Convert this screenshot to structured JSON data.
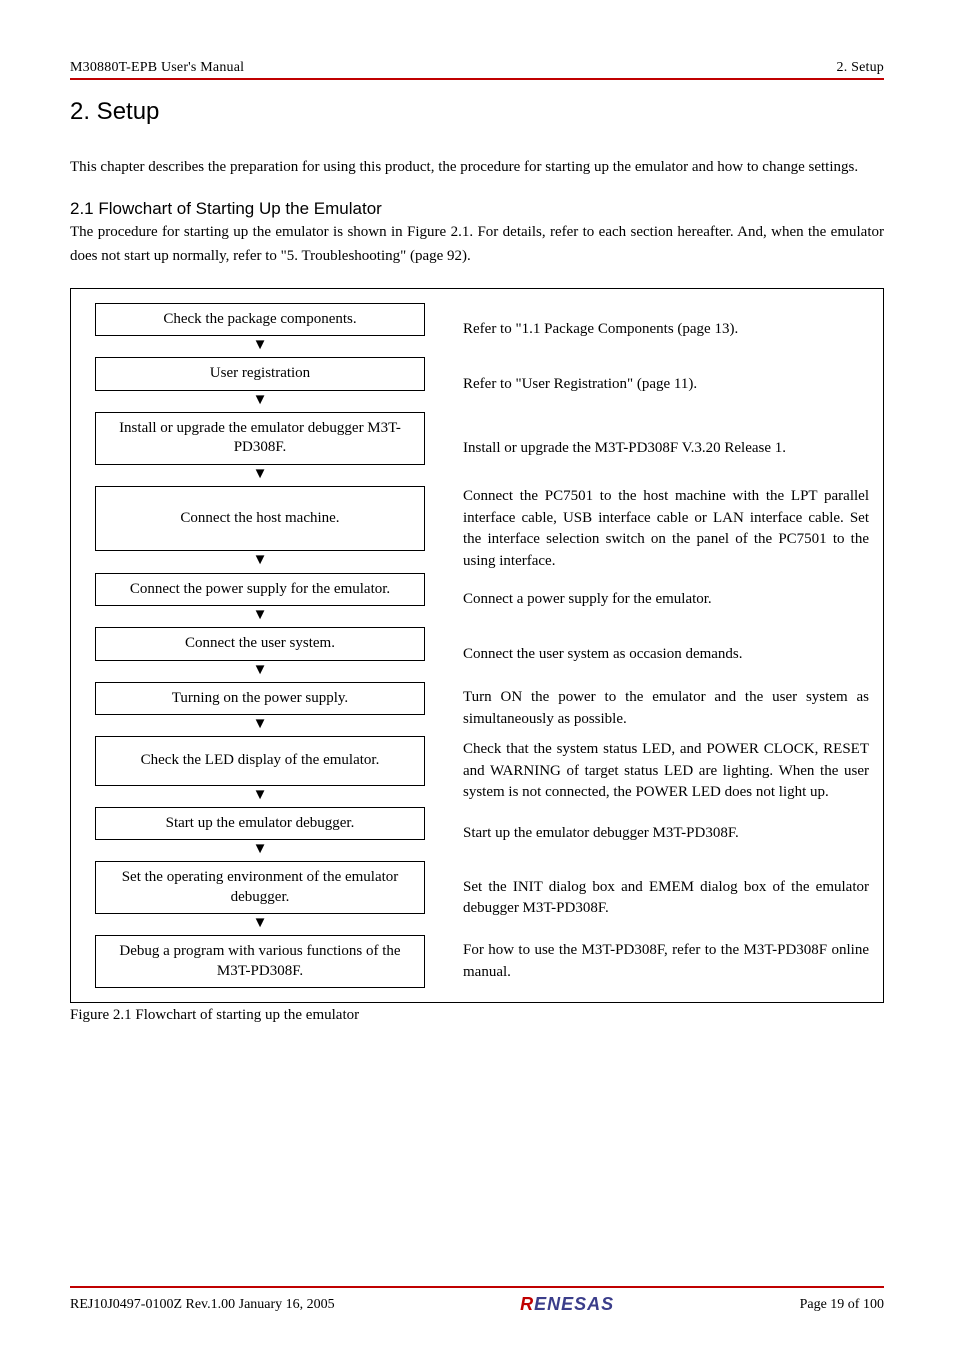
{
  "header": {
    "left": "M30880T-EPB User's Manual",
    "right": "2. Setup"
  },
  "title": "2. Setup",
  "intro": "This chapter describes the preparation for using this product, the procedure for starting up the emulator and how to change settings.",
  "section_heading": "2.1 Flowchart of Starting Up the Emulator",
  "section_intro": "The procedure for starting up the emulator is shown in Figure 2.1. For details, refer to each section hereafter. And, when the emulator does not start up normally, refer to \"5. Troubleshooting\" (page 92).",
  "steps": [
    {
      "box": "Check the package components.",
      "desc": "Refer to \"1.1 Package Components (page 13)."
    },
    {
      "box": "User registration",
      "desc": "Refer to \"User Registration\" (page 11)."
    },
    {
      "box": "Install or upgrade the emulator debugger M3T-PD308F.",
      "desc": "Install or upgrade the M3T-PD308F V.3.20 Release 1."
    },
    {
      "box": "Connect the host machine.",
      "desc": "Connect the PC7501 to the host machine with the LPT parallel interface cable, USB interface cable or LAN interface cable. Set the interface selection switch on the panel of the PC7501 to the using interface."
    },
    {
      "box": "Connect the power supply for the emulator.",
      "desc": "Connect a power supply for the emulator."
    },
    {
      "box": "Connect the user system.",
      "desc": "Connect the user system as occasion demands."
    },
    {
      "box": "Turning on the power supply.",
      "desc": "Turn ON the power to the emulator and the user system as simultaneously as possible."
    },
    {
      "box": "Check the LED display of the emulator.",
      "desc": "Check that the system status LED, and POWER CLOCK, RESET and WARNING of target status LED are lighting. When the user system is not connected, the POWER LED does not light up."
    },
    {
      "box": "Start up the emulator debugger.",
      "desc": "Start up the emulator debugger M3T-PD308F."
    },
    {
      "box": "Set the operating environment of the emulator debugger.",
      "desc": "Set the INIT dialog box and EMEM dialog box of the emulator debugger M3T-PD308F."
    },
    {
      "box": "Debug a program with various functions of the M3T-PD308F.",
      "desc": "For how to use the M3T-PD308F, refer to the M3T-PD308F online manual."
    }
  ],
  "arrow": "▼",
  "figure_caption": "Figure 2.1 Flowchart of starting up the emulator",
  "footer": {
    "left": "REJ10J0497-0100Z   Rev.1.00   January 16, 2005",
    "logo_main": "RENESAS",
    "right": "Page 19 of 100"
  },
  "chart_data": {
    "type": "flowchart",
    "direction": "vertical",
    "nodes": [
      "Check the package components.",
      "User registration",
      "Install or upgrade the emulator debugger M3T-PD308F.",
      "Connect the host machine.",
      "Connect the power supply for the emulator.",
      "Connect the user system.",
      "Turning on the power supply.",
      "Check the LED display of the emulator.",
      "Start up the emulator debugger.",
      "Set the operating environment of the emulator debugger.",
      "Debug a program with various functions of the M3T-PD308F."
    ],
    "annotations": [
      "Refer to \"1.1 Package Components (page 13).",
      "Refer to \"User Registration\" (page 11).",
      "Install or upgrade the M3T-PD308F V.3.20 Release 1.",
      "Connect the PC7501 to the host machine with the LPT parallel interface cable, USB interface cable or LAN interface cable. Set the interface selection switch on the panel of the PC7501 to the using interface.",
      "Connect a power supply for the emulator.",
      "Connect the user system as occasion demands.",
      "Turn ON the power to the emulator and the user system as simultaneously as possible.",
      "Check that the system status LED, and POWER CLOCK, RESET and WARNING of target status LED are lighting. When the user system is not connected, the POWER LED does not light up.",
      "Start up the emulator debugger M3T-PD308F.",
      "Set the INIT dialog box and EMEM dialog box of the emulator debugger M3T-PD308F.",
      "For how to use the M3T-PD308F, refer to the M3T-PD308F online manual."
    ]
  }
}
